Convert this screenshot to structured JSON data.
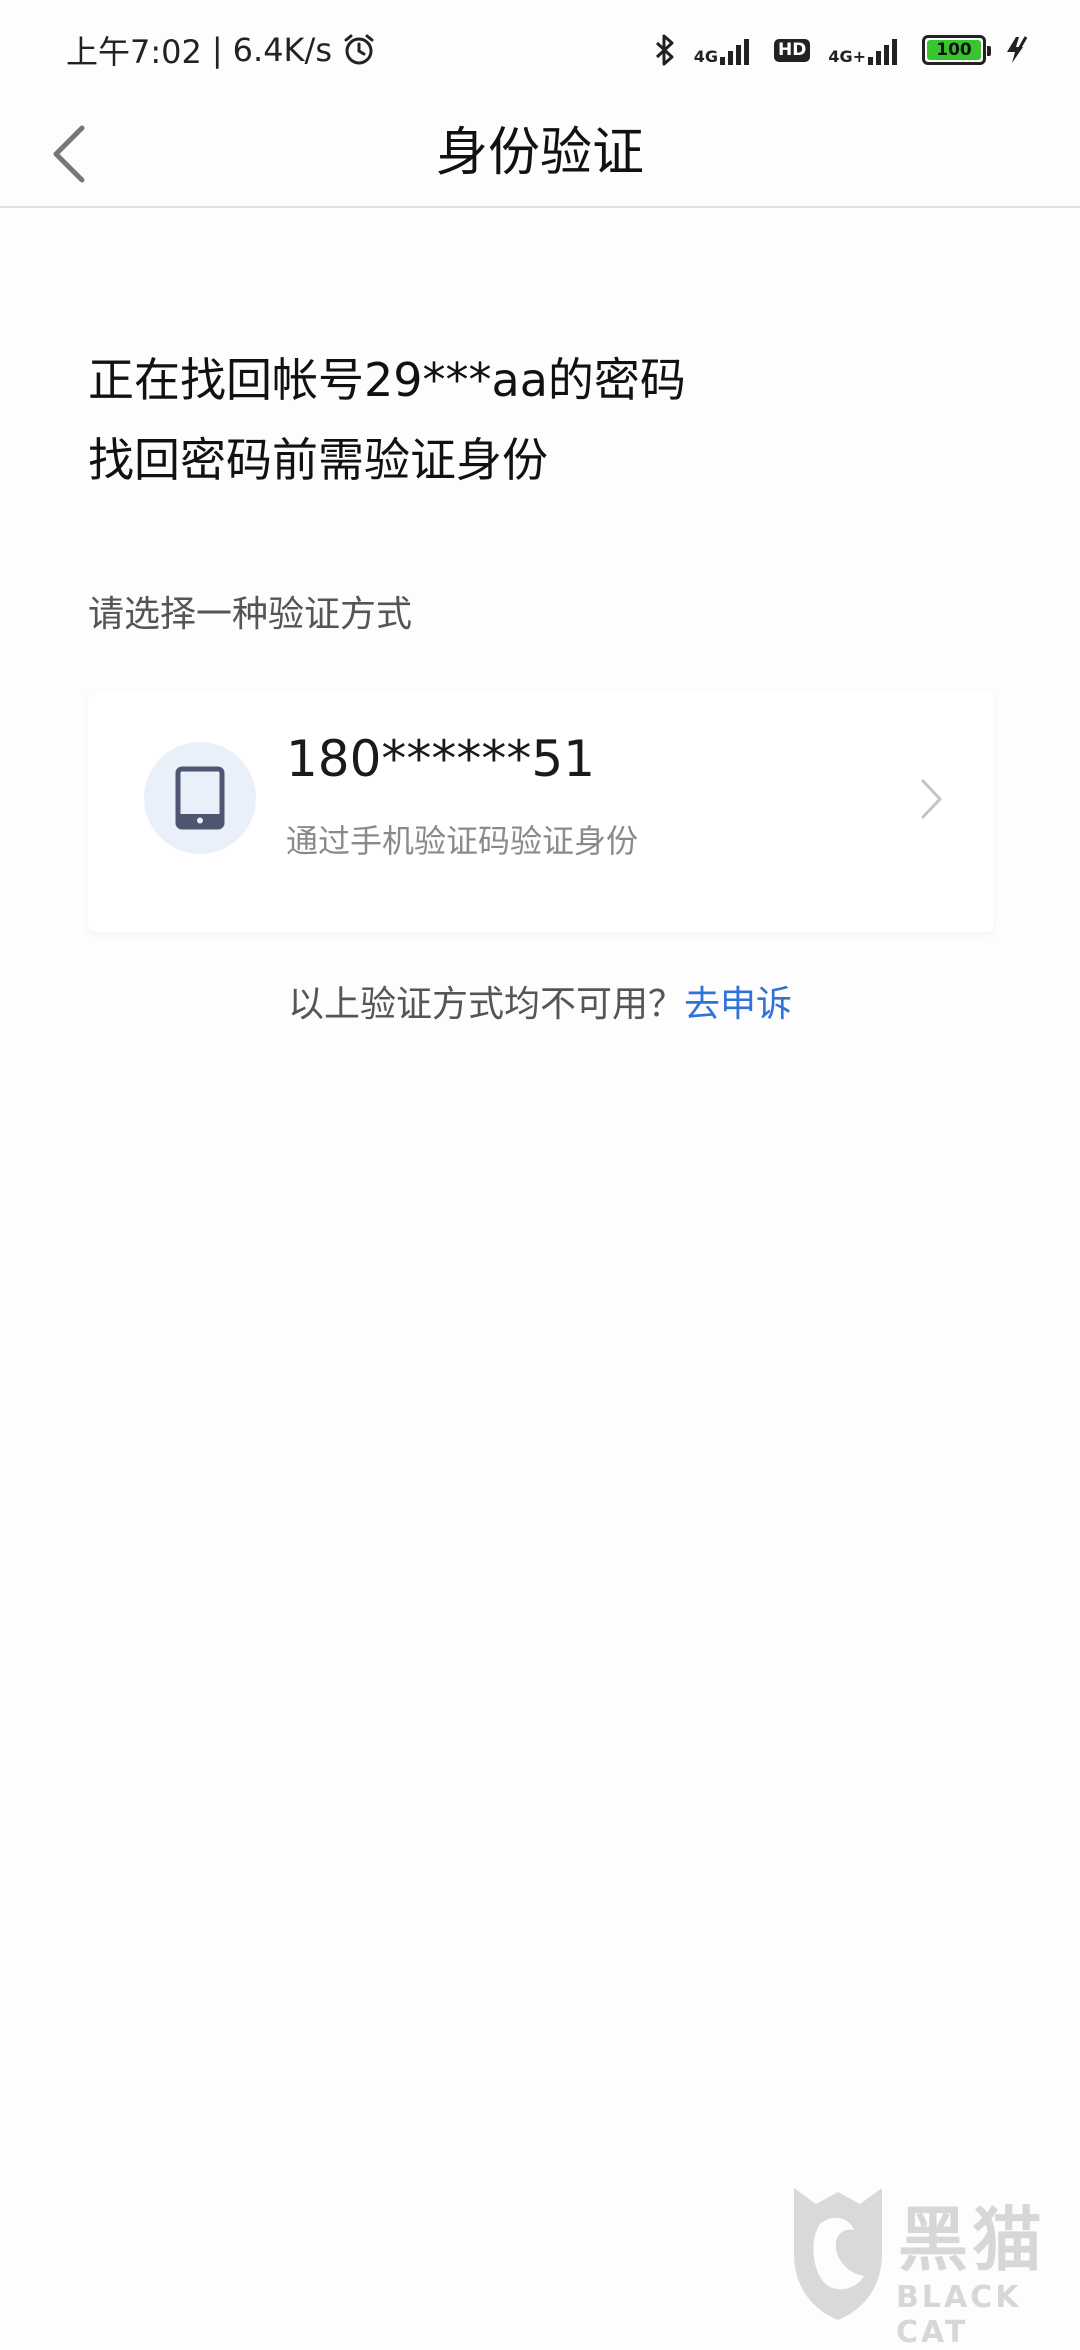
{
  "status_bar": {
    "time": "上午7:02",
    "separator": "|",
    "speed": "6.4K/s",
    "net1": "4G",
    "net2": "4G+",
    "hd": "HD",
    "battery": "100",
    "icons": [
      "alarm-icon",
      "bluetooth-icon",
      "signal-icon",
      "charging-icon"
    ]
  },
  "title_bar": {
    "title": "身份验证",
    "back_icon": "chevron-left-icon"
  },
  "heading": {
    "line1": "正在找回帐号29***aa的密码",
    "line2": "找回密码前需验证身份"
  },
  "subtitle": "请选择一种验证方式",
  "method": {
    "icon": "phone-icon",
    "phone": "180******51",
    "description": "通过手机验证码验证身份",
    "chevron": "chevron-right-icon"
  },
  "appeal": {
    "text": "以上验证方式均不可用？",
    "link": "去申诉"
  },
  "watermark": {
    "cn": "黑猫",
    "en": "BLACK CAT"
  },
  "colors": {
    "background": "#fdfdfd",
    "link": "#2f73d8",
    "icon_circle": "#eaf0fa",
    "icon": "#4d5671",
    "battery": "#39c52f"
  }
}
